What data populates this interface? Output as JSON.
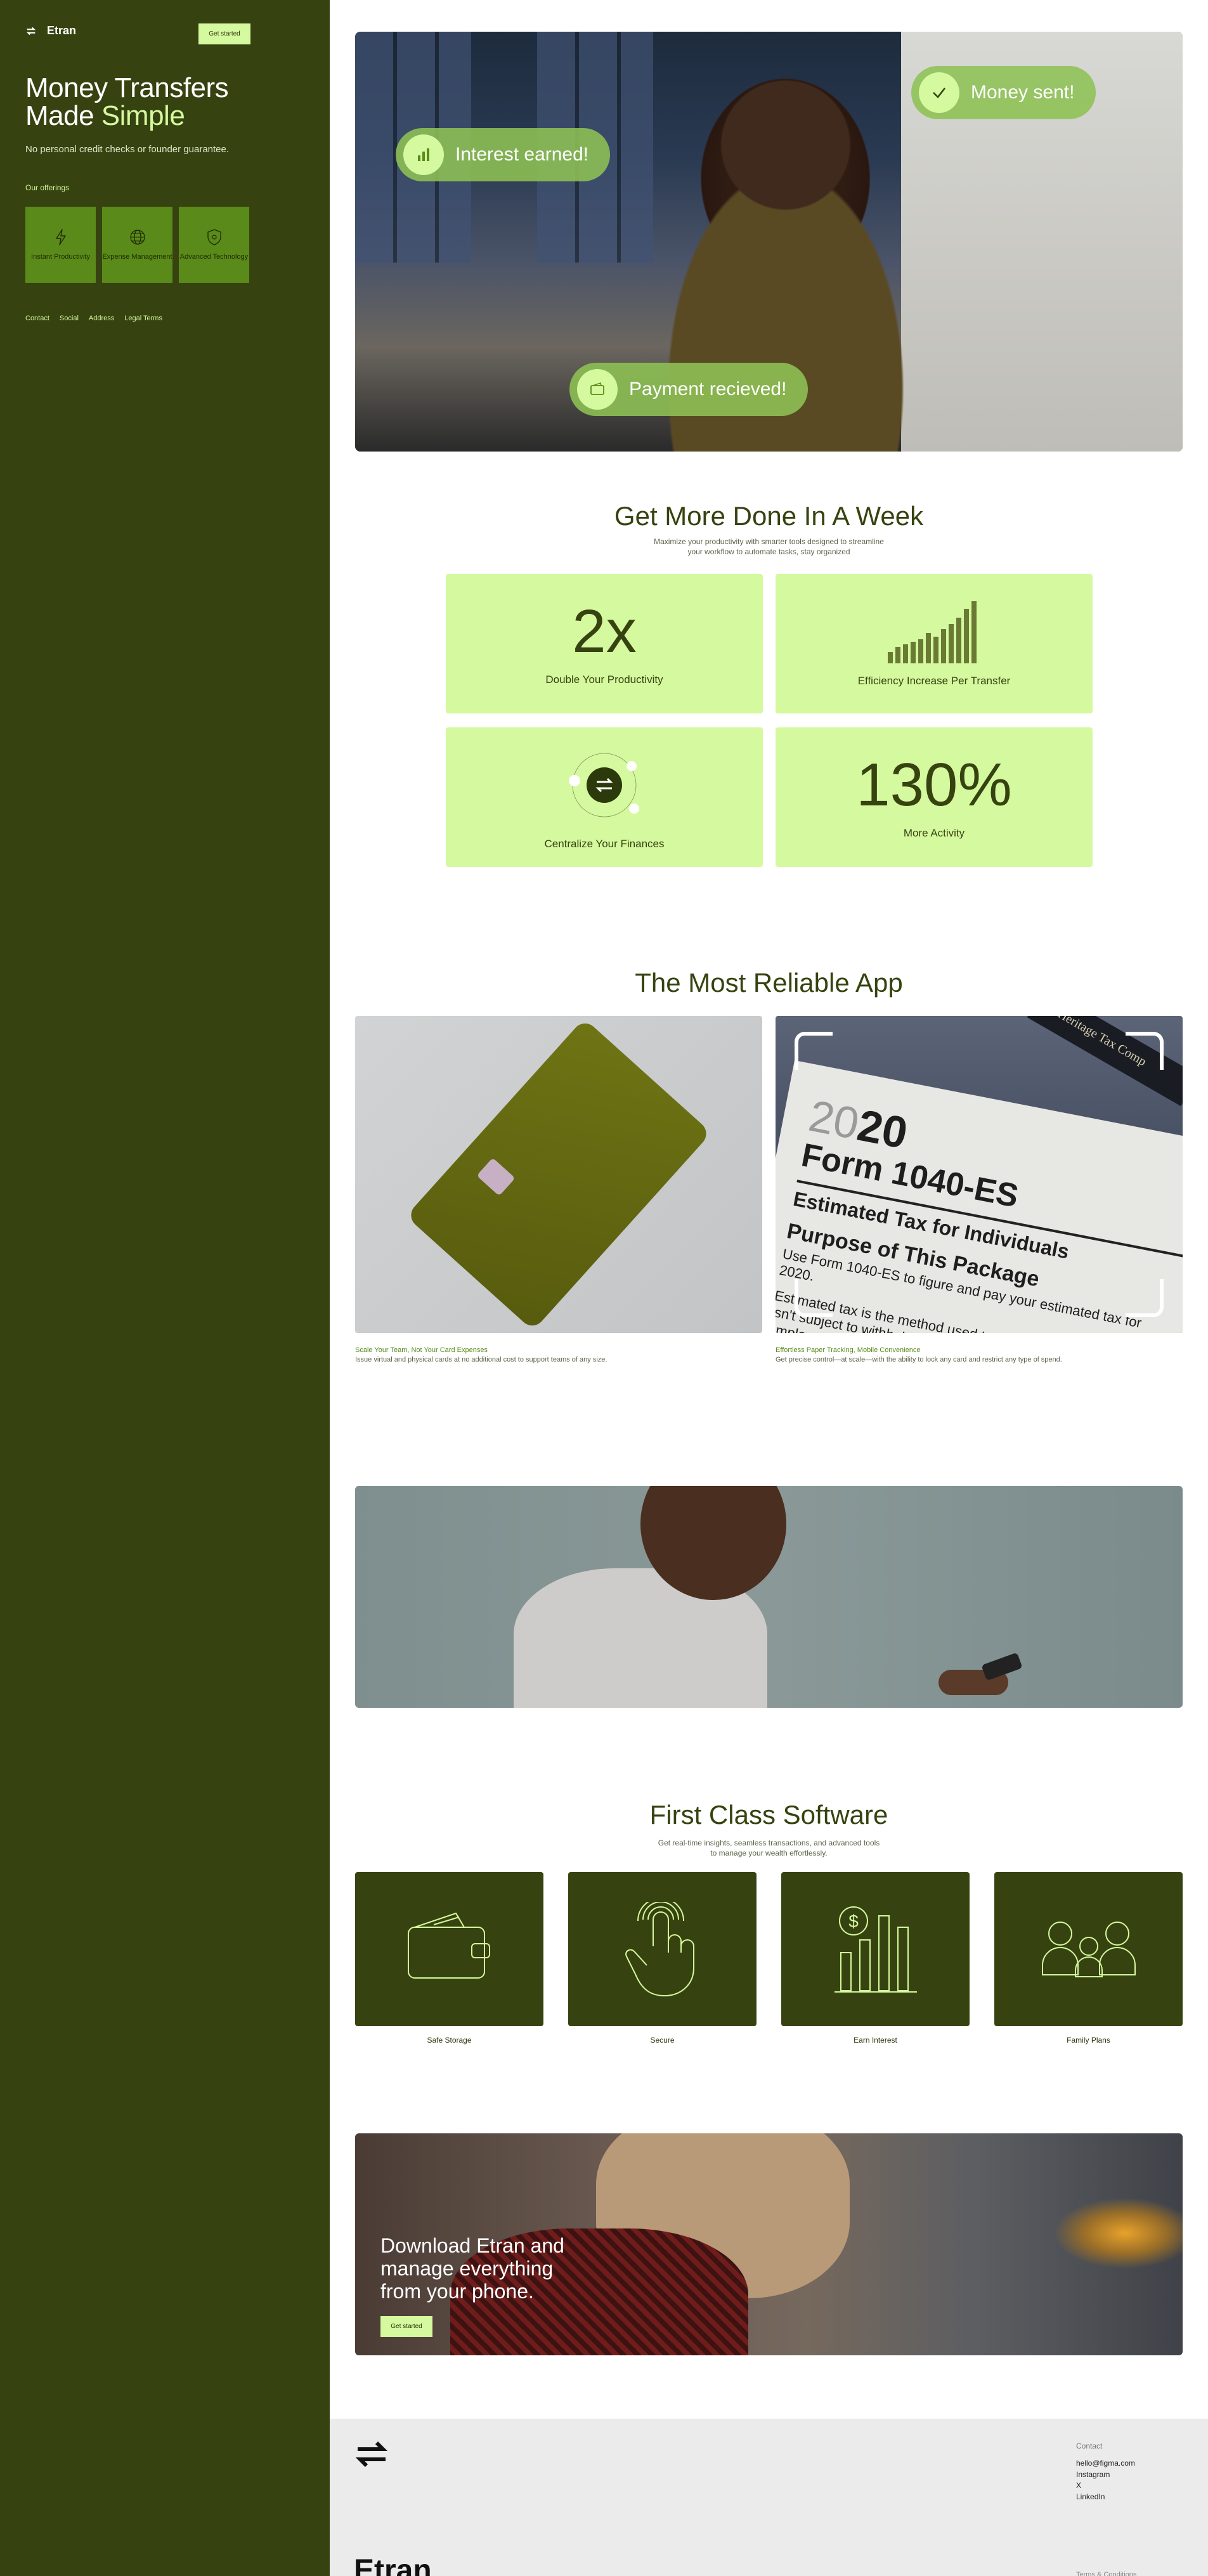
{
  "sidebar": {
    "brand": "Etran",
    "cta": "Get started",
    "title_line1": "Money Transfers",
    "title_line2_a": "Made ",
    "title_line2_b": "Simple",
    "subtitle": "No personal credit checks or founder guarantee.",
    "offerings_heading": "Our offerings",
    "offerings": [
      {
        "label": "Instant Productivity",
        "icon": "lightning-icon"
      },
      {
        "label": "Expense Management",
        "icon": "globe-icon"
      },
      {
        "label": "Advanced Technology",
        "icon": "shield-icon"
      }
    ],
    "links": [
      "Contact",
      "Social",
      "Address",
      "Legal Terms"
    ]
  },
  "hero": {
    "badges": [
      {
        "text": "Interest earned!",
        "icon": "chart-icon"
      },
      {
        "text": "Money sent!",
        "icon": "check-icon"
      },
      {
        "text": "Payment recieved!",
        "icon": "wallet-icon"
      }
    ]
  },
  "productivity": {
    "title": "Get More Done In A Week",
    "subtitle": "Maximize your productivity with smarter tools designed to streamline your workflow to automate tasks, stay organized",
    "stats": [
      {
        "value": "2x",
        "label": "Double Your Productivity"
      },
      {
        "value": "",
        "label": "Efficiency Increase Per Transfer"
      },
      {
        "value": "",
        "label": "Centralize Your Finances"
      },
      {
        "value": "130%",
        "label": "More Activity"
      }
    ]
  },
  "reliable": {
    "title": "The Most Reliable App",
    "cards": [
      {
        "title": "Scale Your Team, Not Your Card Expenses",
        "desc": "Issue virtual and physical cards at no additional cost to support teams of any size."
      },
      {
        "title": "Effortless Paper Tracking, Mobile Convenience",
        "desc": "Get precise control—at scale—with the ability to lock any card and restrict any type of spend."
      }
    ],
    "paper": {
      "year_a": "20",
      "year_b": "20",
      "form": "Form 1040-ES",
      "line1": "Estimated Tax for Individuals",
      "line2": "Purpose of This Package",
      "line3": "Use Form 1040-ES to figure and pay your estimated tax for 2020.",
      "line4": "Estimated tax is the method used to pay tax on income that isn't subject to withholding (for example, earnings from self-employment, interest, dividends, rents, alimony, etc.). In addition,",
      "brand": "Heritage Tax Comp"
    }
  },
  "software": {
    "title": "First Class Software",
    "subtitle": "Get real-time insights, seamless transactions, and advanced tools to manage your wealth effortlessly.",
    "items": [
      {
        "label": "Safe Storage",
        "icon": "wallet-icon"
      },
      {
        "label": "Secure",
        "icon": "fingerprint-icon"
      },
      {
        "label": "Earn Interest",
        "icon": "growth-chart-icon"
      },
      {
        "label": "Family Plans",
        "icon": "family-icon"
      }
    ]
  },
  "download": {
    "title_line1": "Download Etran and",
    "title_line2": "manage everything",
    "title_line3": "from your phone.",
    "cta": "Get started"
  },
  "footer": {
    "contact_heading": "Contact",
    "contacts": [
      "hello@figma.com",
      "Instagram",
      "X",
      "LinkedIn"
    ],
    "wordmark": "Etran",
    "terms": "Terms & Conditions"
  },
  "colors": {
    "sidebar_bg": "#364310",
    "accent": "#d5f99e",
    "offering_bg": "#5a8a19",
    "footer_bg": "#ebebeb"
  }
}
